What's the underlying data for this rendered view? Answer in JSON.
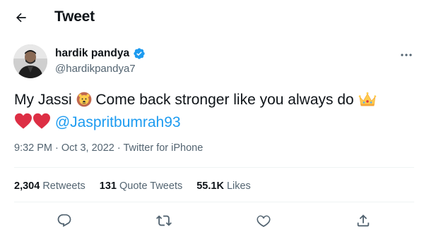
{
  "header": {
    "back_icon": "back-arrow-icon",
    "title": "Tweet"
  },
  "author": {
    "display_name": "hardik pandya",
    "verified_icon": "verified-badge-icon",
    "handle": "@hardikpandya7",
    "more_icon": "more-horizontal-icon"
  },
  "tweet": {
    "text_part1": "My Jassi ",
    "emoji_lion": "lion-face-emoji",
    "text_part2": " Come back stronger like you always do ",
    "emoji_crown": "crown-emoji",
    "emoji_heart": "red-heart-emoji",
    "mention": "@Jaspritbumrah93"
  },
  "meta": {
    "time": "9:32 PM",
    "separator": " · ",
    "date": "Oct 3, 2022",
    "source": "Twitter for iPhone"
  },
  "stats": {
    "retweets_count": "2,304",
    "retweets_label": "Retweets",
    "quotes_count": "131",
    "quotes_label": "Quote Tweets",
    "likes_count": "55.1K",
    "likes_label": "Likes"
  },
  "actions": {
    "reply_icon": "reply-icon",
    "retweet_icon": "retweet-icon",
    "like_icon": "like-icon",
    "share_icon": "share-icon"
  },
  "colors": {
    "accent": "#1d9bf0",
    "text": "#0f1419",
    "secondary": "#536471",
    "divider": "#eff3f4",
    "heart": "#dd2e44",
    "crown": "#ffcc4d"
  }
}
